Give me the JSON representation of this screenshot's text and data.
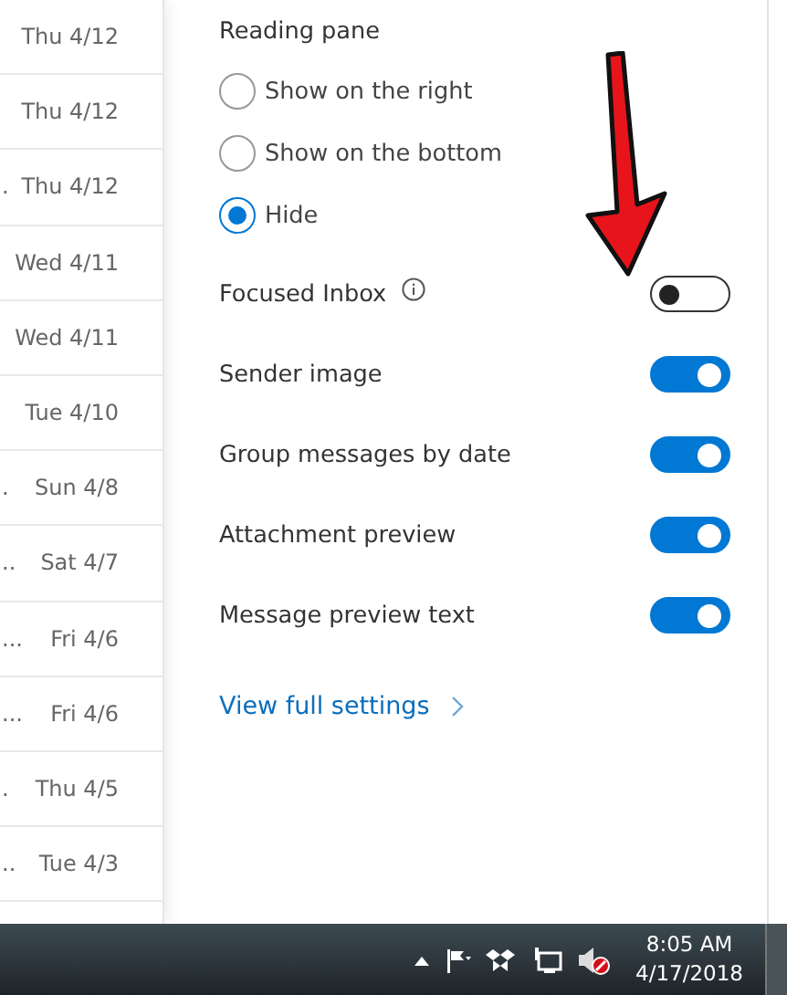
{
  "message_list": [
    {
      "date": "Thu 4/12"
    },
    {
      "date": "Thu 4/12"
    },
    {
      "snippet": ".",
      "date": "Thu 4/12"
    },
    {
      "date": "Wed 4/11"
    },
    {
      "date": "Wed 4/11"
    },
    {
      "date": "Tue 4/10"
    },
    {
      "snippet": ".",
      "date": "Sun 4/8"
    },
    {
      "snippet": "..",
      "date": "Sat 4/7"
    },
    {
      "snippet": "...",
      "date": "Fri 4/6"
    },
    {
      "snippet": "...",
      "date": "Fri 4/6"
    },
    {
      "snippet": ".",
      "date": "Thu 4/5"
    },
    {
      "snippet": "..",
      "date": "Tue 4/3"
    }
  ],
  "settings": {
    "section_title": "Reading pane",
    "radios": [
      {
        "label": "Show on the right",
        "selected": false
      },
      {
        "label": "Show on the bottom",
        "selected": false
      },
      {
        "label": "Hide",
        "selected": true
      }
    ],
    "toggles": [
      {
        "label": "Focused Inbox",
        "info": true,
        "on": false
      },
      {
        "label": "Sender image",
        "info": false,
        "on": true
      },
      {
        "label": "Group messages by date",
        "info": false,
        "on": true
      },
      {
        "label": "Attachment preview",
        "info": false,
        "on": true
      },
      {
        "label": "Message preview text",
        "info": false,
        "on": true
      }
    ],
    "link": "View full settings"
  },
  "annotation": {
    "kind": "arrow"
  },
  "taskbar": {
    "time": "8:05 AM",
    "date": "4/17/2018"
  }
}
